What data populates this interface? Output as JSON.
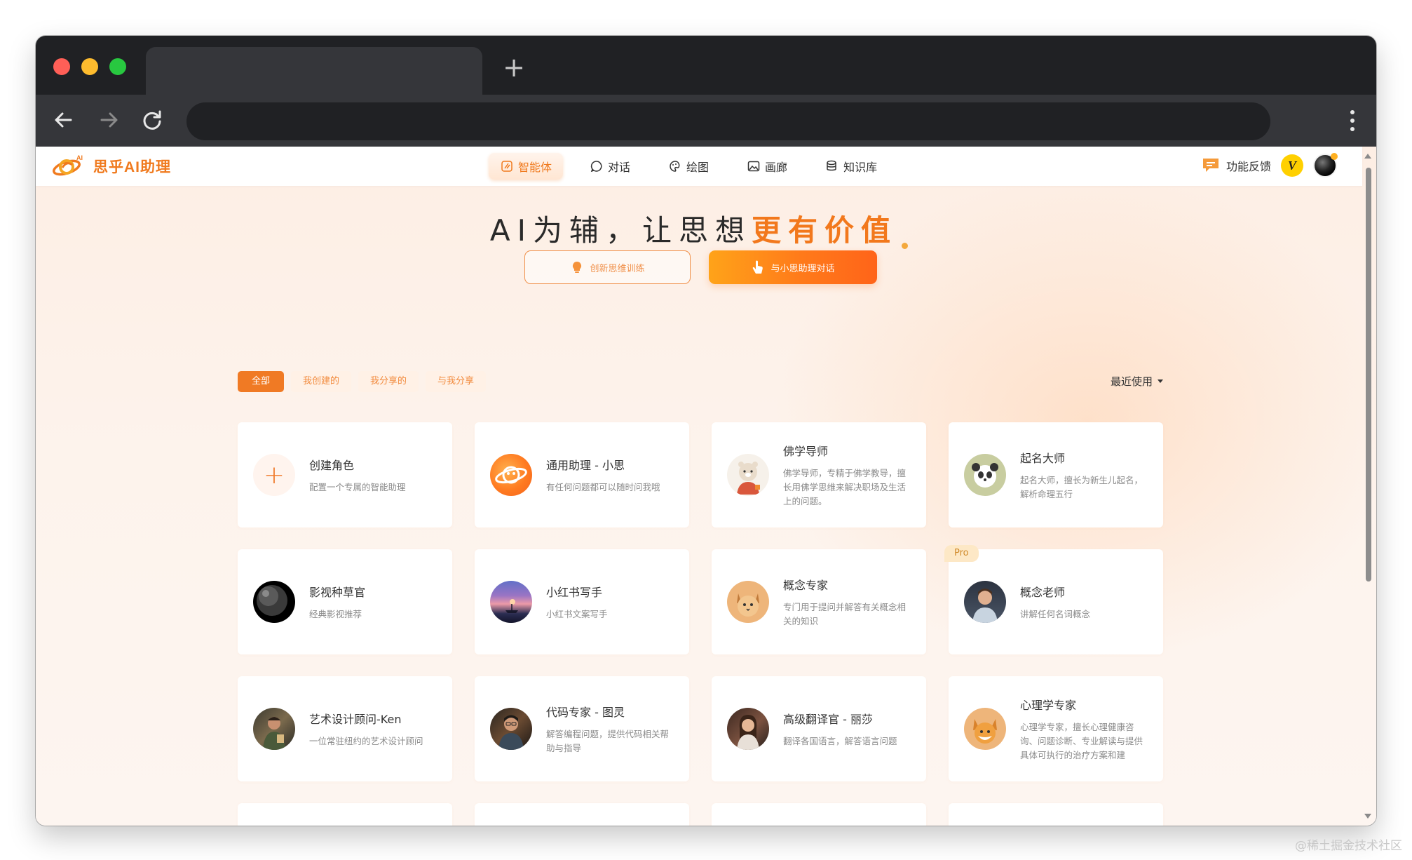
{
  "app": {
    "logo_text": "思乎AI助理",
    "brand_color": "#f07a1e"
  },
  "nav": {
    "items": [
      {
        "label": "智能体",
        "icon": "agent-icon",
        "active": true
      },
      {
        "label": "对话",
        "icon": "chat-icon",
        "active": false
      },
      {
        "label": "绘图",
        "icon": "palette-icon",
        "active": false
      },
      {
        "label": "画廊",
        "icon": "gallery-icon",
        "active": false
      },
      {
        "label": "知识库",
        "icon": "database-icon",
        "active": false
      }
    ]
  },
  "header_right": {
    "feedback_label": "功能反馈",
    "vip_badge": "V"
  },
  "hero": {
    "title_plain": "AI为辅，让思想",
    "title_highlight": "更有价值",
    "buttons": {
      "secondary": "创新思维训练",
      "primary": "与小思助理对话"
    }
  },
  "filters": {
    "chips": [
      "全部",
      "我创建的",
      "我分享的",
      "与我分享"
    ],
    "active_index": 0,
    "sort_label": "最近使用"
  },
  "cards": [
    {
      "name": "创建角色",
      "desc": "配置一个专属的智能助理",
      "avatar": "plus-icon"
    },
    {
      "name": "通用助理 - 小思",
      "desc": "有任何问题都可以随时问我哦",
      "avatar": "xiaosi-logo"
    },
    {
      "name": "佛学导师",
      "desc": "佛学导师，专精于佛学教导，擅长用佛学思维来解决职场及生活上的问题。",
      "avatar": "bear-monk-avatar"
    },
    {
      "name": "起名大师",
      "desc": "起名大师，擅长为新生儿起名，解析命理五行",
      "avatar": "panda-avatar"
    },
    {
      "name": "影视种草官",
      "desc": "经典影视推荐",
      "avatar": "dark-planet-avatar"
    },
    {
      "name": "小红书写手",
      "desc": "小红书文案写手",
      "avatar": "sunset-boat-avatar"
    },
    {
      "name": "概念专家",
      "desc": "专门用于提问并解答有关概念相关的知识",
      "avatar": "cat-avatar"
    },
    {
      "name": "概念老师",
      "desc": "讲解任何名词概念",
      "avatar": "teacher-avatar",
      "badge": "Pro"
    },
    {
      "name": "艺术设计顾问-Ken",
      "desc": "一位常驻纽约的艺术设计顾问",
      "avatar": "designer-avatar"
    },
    {
      "name": "代码专家 - 图灵",
      "desc": "解答编程问题，提供代码相关帮助与指导",
      "avatar": "coder-avatar"
    },
    {
      "name": "高级翻译官 - 丽莎",
      "desc": "翻译各国语言，解答语言问题",
      "avatar": "translator-avatar"
    },
    {
      "name": "心理学专家",
      "desc": "心理学专家，擅长心理健康咨询、问题诊断、专业解读与提供具体可执行的治疗方案和建",
      "avatar": "fox-avatar"
    }
  ],
  "watermark": "@稀土掘金技术社区"
}
